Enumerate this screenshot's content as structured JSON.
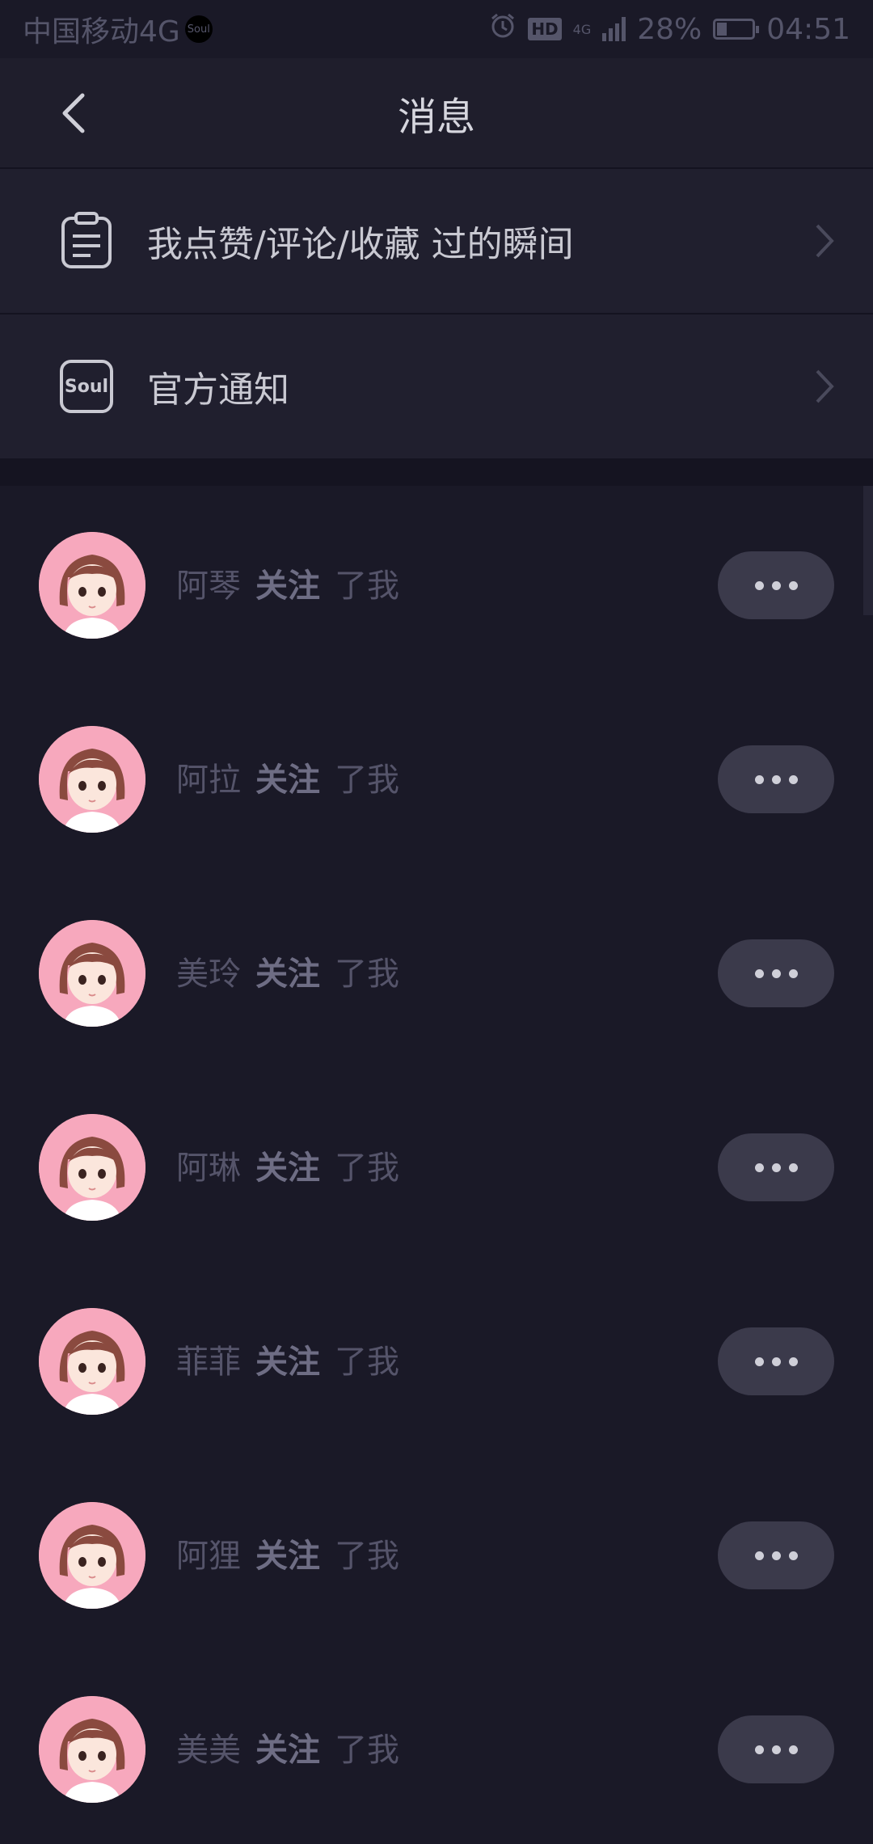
{
  "status_bar": {
    "carrier": "中国移动4G",
    "app_badge": "Soul",
    "hd": "HD",
    "network": "4G",
    "battery": "28%",
    "battery_level": 0.28,
    "time": "04:51"
  },
  "nav": {
    "title": "消息"
  },
  "menu": [
    {
      "label": "我点赞/评论/收藏 过的瞬间",
      "icon": "clipboard-icon"
    },
    {
      "label": "官方通知",
      "icon": "soul-logo-icon",
      "icon_text": "Soul"
    }
  ],
  "notifications": [
    {
      "name": "阿琴",
      "action": "关注",
      "suffix": "了我"
    },
    {
      "name": "阿拉",
      "action": "关注",
      "suffix": "了我"
    },
    {
      "name": "美玲",
      "action": "关注",
      "suffix": "了我"
    },
    {
      "name": "阿琳",
      "action": "关注",
      "suffix": "了我"
    },
    {
      "name": "菲菲",
      "action": "关注",
      "suffix": "了我"
    },
    {
      "name": "阿狸",
      "action": "关注",
      "suffix": "了我"
    },
    {
      "name": "美美",
      "action": "关注",
      "suffix": "了我"
    }
  ],
  "colors": {
    "background": "#1a1927",
    "row_background": "#201f2e",
    "more_button": "#3b3a4b",
    "avatar_bg": "#f7a8bd"
  }
}
